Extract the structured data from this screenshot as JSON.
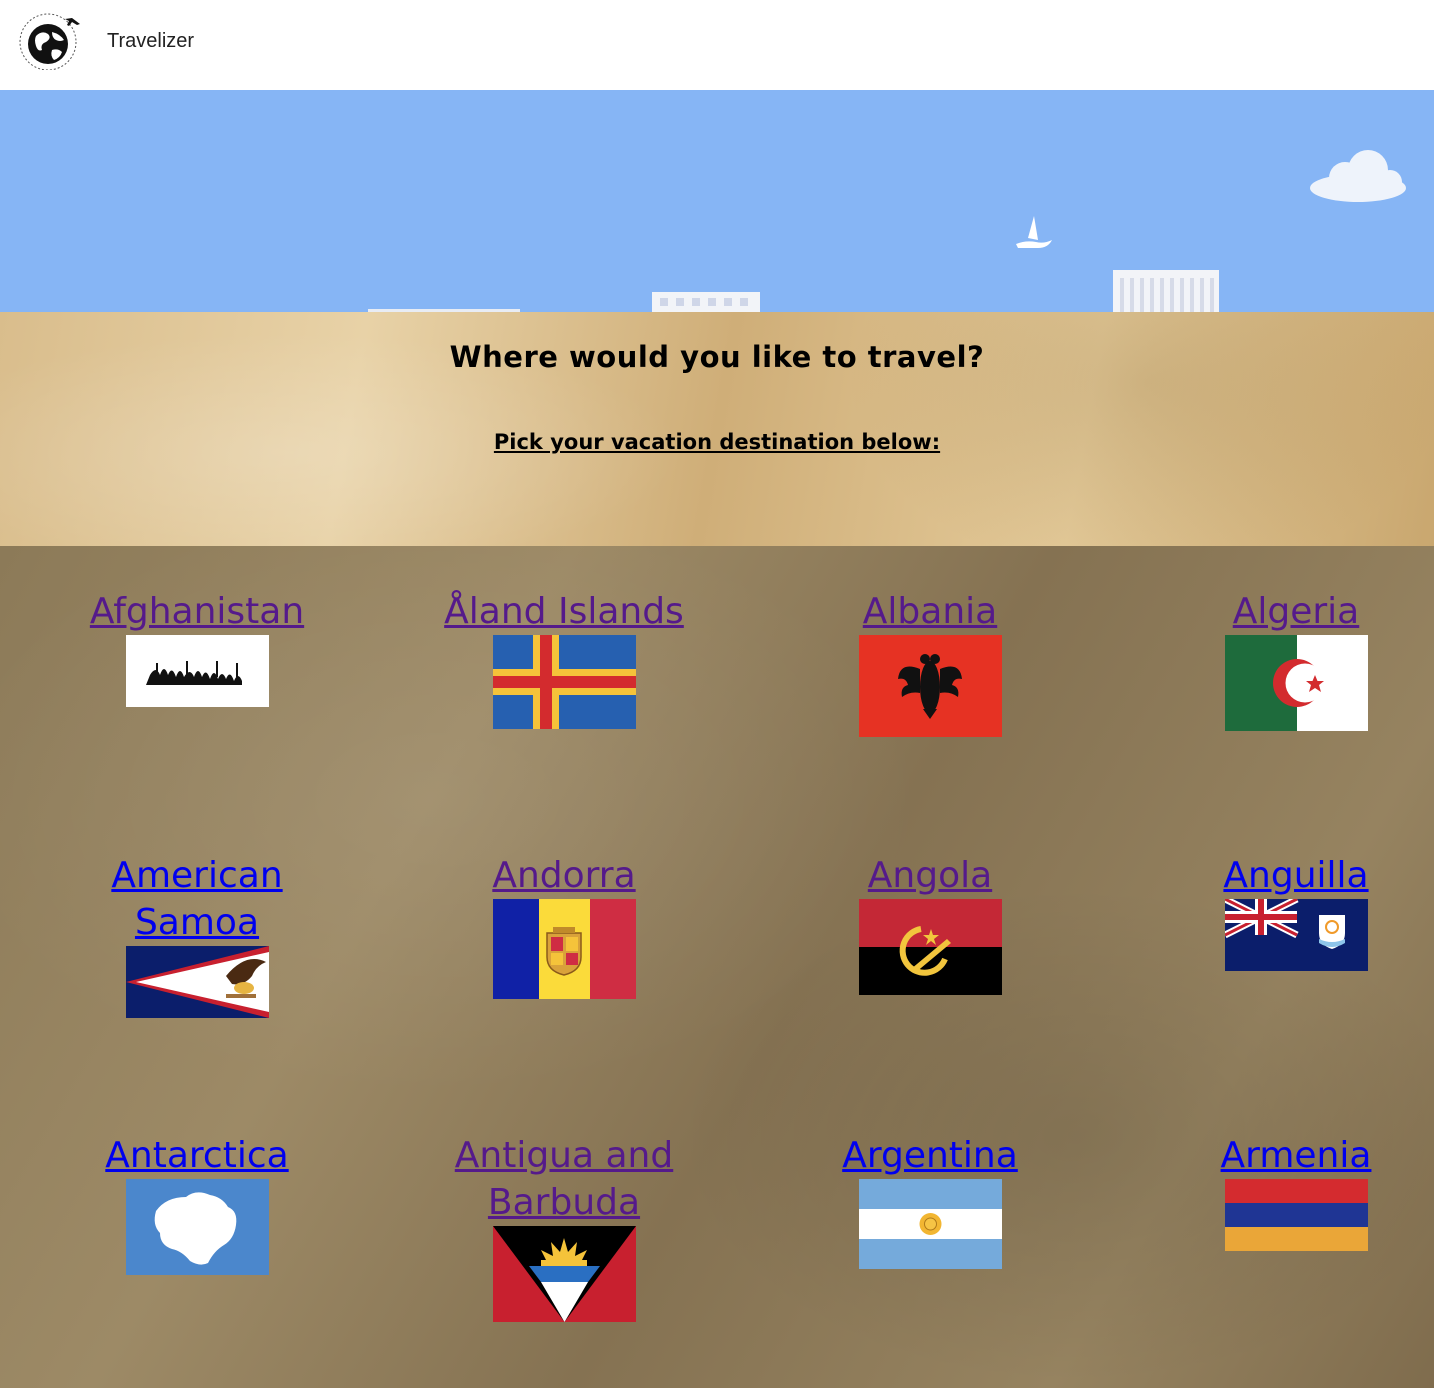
{
  "navbar": {
    "brand": "Travelizer",
    "logo_icon": "globe-airplane-icon"
  },
  "hero": {
    "headline": "Where would you like to travel?",
    "subhead": "Pick your vacation destination below:"
  },
  "countries": [
    {
      "name": "Afghanistan",
      "flag": "afghanistan-flag-icon",
      "visited": true
    },
    {
      "name": "Åland Islands",
      "flag": "aland-islands-flag-icon",
      "visited": true
    },
    {
      "name": "Albania",
      "flag": "albania-flag-icon",
      "visited": true
    },
    {
      "name": "Algeria",
      "flag": "algeria-flag-icon",
      "visited": true
    },
    {
      "name": "American Samoa",
      "flag": "american-samoa-flag-icon",
      "visited": false
    },
    {
      "name": "Andorra",
      "flag": "andorra-flag-icon",
      "visited": true
    },
    {
      "name": "Angola",
      "flag": "angola-flag-icon",
      "visited": true
    },
    {
      "name": "Anguilla",
      "flag": "anguilla-flag-icon",
      "visited": false
    },
    {
      "name": "Antarctica",
      "flag": "antarctica-flag-icon",
      "visited": false
    },
    {
      "name": "Antigua and Barbuda",
      "flag": "antigua-and-barbuda-flag-icon",
      "visited": true
    },
    {
      "name": "Argentina",
      "flag": "argentina-flag-icon",
      "visited": false
    },
    {
      "name": "Armenia",
      "flag": "armenia-flag-icon",
      "visited": false
    }
  ],
  "colors": {
    "sky": "#86b5f5",
    "link_visited": "#551a8b",
    "link_unvisited": "#0000ee"
  }
}
